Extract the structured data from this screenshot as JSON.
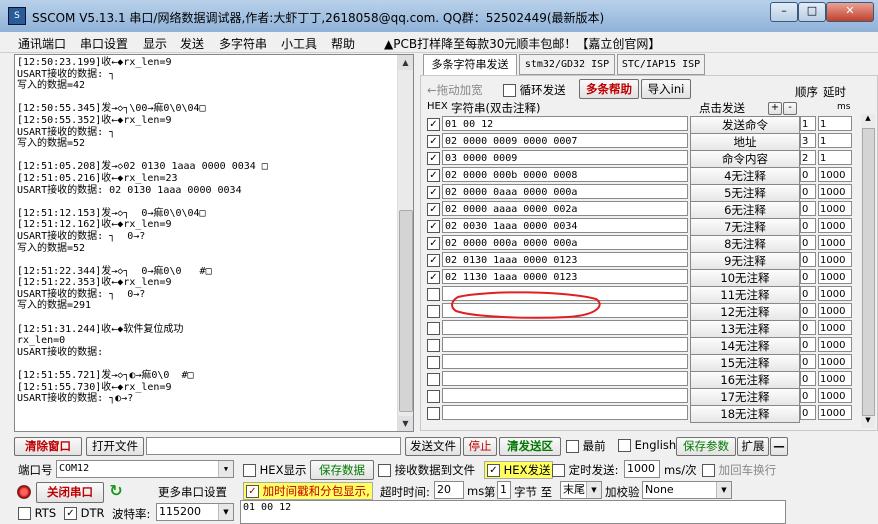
{
  "titlebar": {
    "title": "SSCOM V5.13.1 串口/网络数据调试器,作者:大虾丁丁,2618058@qq.com. QQ群：52502449(最新版本)",
    "min": "–",
    "max": "□",
    "close": "✕"
  },
  "menu": {
    "items": [
      "通讯端口",
      "串口设置",
      "显示",
      "发送",
      "多字符串",
      "小工具",
      "帮助"
    ],
    "ad": "▲PCB打样降至每款30元顺丰包邮！【嘉立创官网】"
  },
  "receive": {
    "lines": [
      "[12:50:23.199]收←◆rx_len=9",
      "USART接收的数据: ┐",
      "写入的数据=42",
      "",
      "[12:50:55.345]发→◇┐\\00→痲0\\0\\04□",
      "[12:50:55.352]收←◆rx_len=9",
      "USART接收的数据: ┐",
      "写入的数据=52",
      "",
      "[12:51:05.208]发→◇02 0130 1aaa 0000 0034 □",
      "[12:51:05.216]收←◆rx_len=23",
      "USART接收的数据: 02 0130 1aaa 0000 0034",
      "",
      "[12:51:12.153]发→◇┐  0→痲0\\0\\04□",
      "[12:51:12.162]收←◆rx_len=9",
      "USART接收的数据: ┐  0→?",
      "写入的数据=52",
      "",
      "[12:51:22.344]发→◇┐  0→痲0\\0   #□",
      "[12:51:22.353]收←◆rx_len=9",
      "USART接收的数据: ┐  0→?",
      "写入的数据=291",
      "",
      "[12:51:31.244]收←◆软件复位成功",
      "rx_len=0",
      "USART接收的数据:",
      "",
      "[12:51:55.721]发→◇┐◐→痲0\\0  #□",
      "[12:51:55.730]收←◆rx_len=9",
      "USART接收的数据: ┐◐→?"
    ]
  },
  "tabs": [
    "多条字符串发送",
    "stm32/GD32 ISP",
    "STC/IAP15 ISP"
  ],
  "multi": {
    "drag_label": "←拖动加宽",
    "loop_label": "循环发送",
    "help_label": "多条帮助",
    "import_label": "导入ini",
    "order_label": "顺序",
    "delay_label": "延时",
    "hex_label": "HEX",
    "string_header": "字符串(双击注释)",
    "click_send": "点击发送",
    "plus": "+",
    "minus": "-",
    "ms_label": "ms",
    "rows": [
      {
        "checked": true,
        "text": "01 00 12",
        "button": "发送命令",
        "order": "1",
        "delay": "1"
      },
      {
        "checked": true,
        "text": "02 0000 0009 0000 0007",
        "button": "地址",
        "order": "3",
        "delay": "1"
      },
      {
        "checked": true,
        "text": "03 0000 0009",
        "button": "命令内容",
        "order": "2",
        "delay": "1"
      },
      {
        "checked": true,
        "text": "02 0000 000b 0000 0008",
        "button": "4无注释",
        "order": "0",
        "delay": "1000"
      },
      {
        "checked": true,
        "text": "02 0000 0aaa 0000 000a",
        "button": "5无注释",
        "order": "0",
        "delay": "1000"
      },
      {
        "checked": true,
        "text": "02 0000 aaaa 0000 002a",
        "button": "6无注释",
        "order": "0",
        "delay": "1000"
      },
      {
        "checked": true,
        "text": "02 0030 1aaa 0000 0034",
        "button": "7无注释",
        "order": "0",
        "delay": "1000"
      },
      {
        "checked": true,
        "text": "02 0000 000a 0000 000a",
        "button": "8无注释",
        "order": "0",
        "delay": "1000"
      },
      {
        "checked": true,
        "text": "02 0130 1aaa 0000 0123",
        "button": "9无注释",
        "order": "0",
        "delay": "1000"
      },
      {
        "checked": true,
        "text": "02 1130 1aaa 0000 0123",
        "button": "10无注释",
        "order": "0",
        "delay": "1000"
      },
      {
        "checked": false,
        "text": "",
        "button": "11无注释",
        "order": "0",
        "delay": "1000"
      },
      {
        "checked": false,
        "text": "",
        "button": "12无注释",
        "order": "0",
        "delay": "1000"
      },
      {
        "checked": false,
        "text": "",
        "button": "13无注释",
        "order": "0",
        "delay": "1000"
      },
      {
        "checked": false,
        "text": "",
        "button": "14无注释",
        "order": "0",
        "delay": "1000"
      },
      {
        "checked": false,
        "text": "",
        "button": "15无注释",
        "order": "0",
        "delay": "1000"
      },
      {
        "checked": false,
        "text": "",
        "button": "16无注释",
        "order": "0",
        "delay": "1000"
      },
      {
        "checked": false,
        "text": "",
        "button": "17无注释",
        "order": "0",
        "delay": "1000"
      },
      {
        "checked": false,
        "text": "",
        "button": "18无注释",
        "order": "0",
        "delay": "1000"
      }
    ]
  },
  "toolbar": {
    "clear_window": "清除窗口",
    "open_file": "打开文件",
    "file_path": "",
    "send_file": "发送文件",
    "stop": "停止",
    "clear_send": "清发送区",
    "topmost": "最前",
    "english": "English",
    "save_params": "保存参数",
    "expand": "扩展",
    "collapse": "—"
  },
  "port": {
    "port_label": "端口号",
    "port_value": "COM12",
    "close_port": "关闭串口",
    "more_settings": "更多串口设置",
    "rts": "RTS",
    "dtr": "DTR",
    "baud_label": "波特率:",
    "baud_value": "115200",
    "rts_checked": false,
    "dtr_checked": true
  },
  "options": {
    "hex_display": "HEX显示",
    "save_data": "保存数据",
    "recv_to_file": "接收数据到文件",
    "hex_send": "HEX发送",
    "timed_send": "定时发送:",
    "timed_value": "1000",
    "ms_per": "ms/次",
    "add_crlf": "加回车换行",
    "timestamp": "加时间戳和分包显示,",
    "timeout_label": "超时时间:",
    "timeout_value": "20",
    "ms": "ms",
    "nth_label": "第",
    "nth_value": "1",
    "byte_label": "字节 至",
    "end_value": "末尾",
    "checksum_label": "加校验",
    "checksum_value": "None"
  },
  "send_area": {
    "text": "01 00 12"
  }
}
